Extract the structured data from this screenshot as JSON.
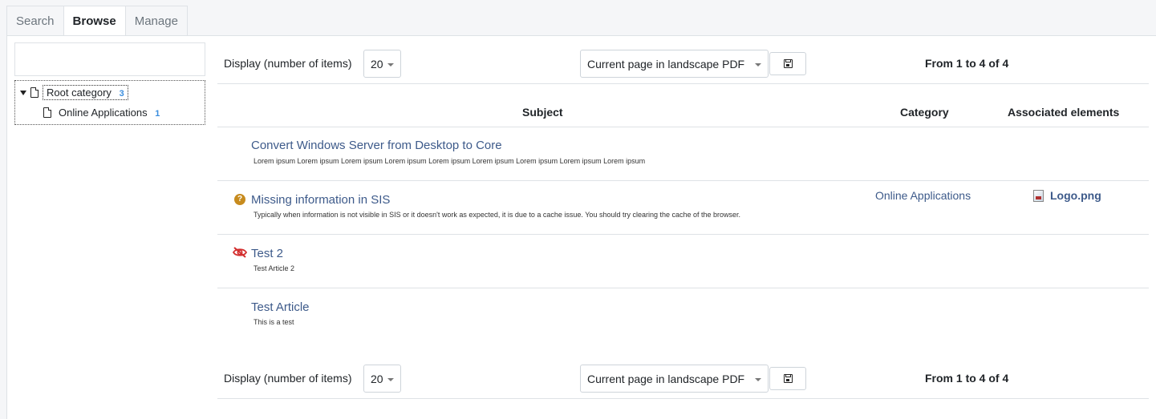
{
  "tabs": [
    {
      "label": "Search"
    },
    {
      "label": "Browse"
    },
    {
      "label": "Manage"
    }
  ],
  "tree": {
    "search_placeholder": "",
    "nodes": [
      {
        "label": "Root category",
        "count": "3"
      },
      {
        "label": "Online Applications",
        "count": "1"
      }
    ]
  },
  "toolbar": {
    "display_label": "Display (number of items)",
    "display_value": "20",
    "export_value": "Current page in landscape PDF",
    "pager_text": "From 1 to 4 of 4"
  },
  "table": {
    "headers": {
      "subject": "Subject",
      "category": "Category",
      "associated": "Associated elements"
    },
    "rows": [
      {
        "title": "Convert Windows Server from Desktop to Core",
        "description": "Lorem ipsum Lorem ipsum Lorem ipsum Lorem ipsum Lorem ipsum Lorem ipsum Lorem ipsum Lorem ipsum Lorem ipsum",
        "category": "",
        "associated": "",
        "status_icon": "none"
      },
      {
        "title": "Missing information in SIS",
        "description": "Typically when information is not visible in SIS or it doesn't work as expected, it is due to a cache issue. You should try clearing the cache of the browser.",
        "category": "Online Applications",
        "associated": "Logo.png",
        "status_icon": "question-circle-icon"
      },
      {
        "title": "Test 2",
        "description": "Test Article 2",
        "category": "",
        "associated": "",
        "status_icon": "eye-slash-icon"
      },
      {
        "title": "Test Article",
        "description": "This is a test",
        "category": "",
        "associated": "",
        "status_icon": "none"
      }
    ]
  },
  "colors": {
    "link": "#3d5a8a",
    "count_badge": "#3a8dde",
    "help_icon": "#c78b1e",
    "hidden_icon": "#d32f2f"
  }
}
